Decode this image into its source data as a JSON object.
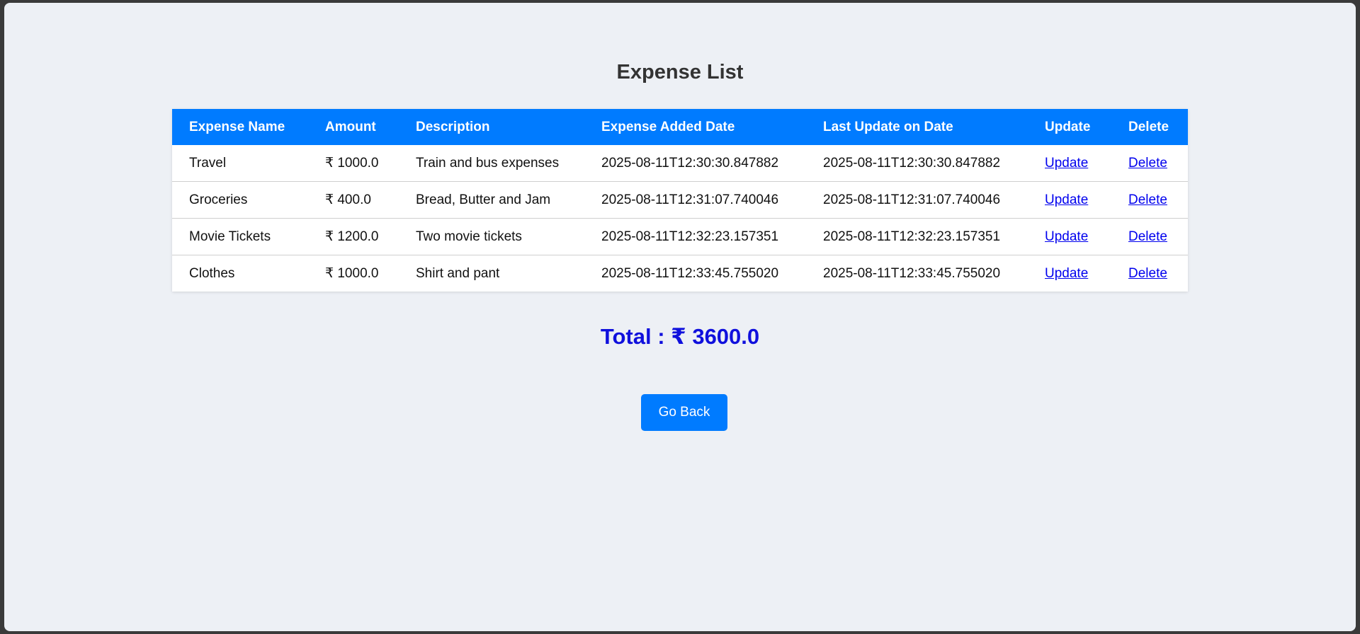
{
  "page": {
    "title": "Expense List"
  },
  "table": {
    "headers": [
      "Expense Name",
      "Amount",
      "Description",
      "Expense Added Date",
      "Last Update on Date",
      "Update",
      "Delete"
    ],
    "rows": [
      {
        "name": "Travel",
        "amount": "₹ 1000.0",
        "description": "Train and bus expenses",
        "added": "2025-08-11T12:30:30.847882",
        "updated": "2025-08-11T12:30:30.847882",
        "update_link": "Update",
        "delete_link": "Delete"
      },
      {
        "name": "Groceries",
        "amount": "₹ 400.0",
        "description": "Bread, Butter and Jam",
        "added": "2025-08-11T12:31:07.740046",
        "updated": "2025-08-11T12:31:07.740046",
        "update_link": "Update",
        "delete_link": "Delete"
      },
      {
        "name": "Movie Tickets",
        "amount": "₹ 1200.0",
        "description": "Two movie tickets",
        "added": "2025-08-11T12:32:23.157351",
        "updated": "2025-08-11T12:32:23.157351",
        "update_link": "Update",
        "delete_link": "Delete"
      },
      {
        "name": "Clothes",
        "amount": "₹ 1000.0",
        "description": "Shirt and pant",
        "added": "2025-08-11T12:33:45.755020",
        "updated": "2025-08-11T12:33:45.755020",
        "update_link": "Update",
        "delete_link": "Delete"
      }
    ]
  },
  "total": {
    "text": "Total : ₹ 3600.0"
  },
  "actions": {
    "go_back_label": "Go Back"
  },
  "colors": {
    "accent": "#007bff",
    "total_text": "#1010dd",
    "link": "#0000ee",
    "background": "#edf0f5"
  }
}
